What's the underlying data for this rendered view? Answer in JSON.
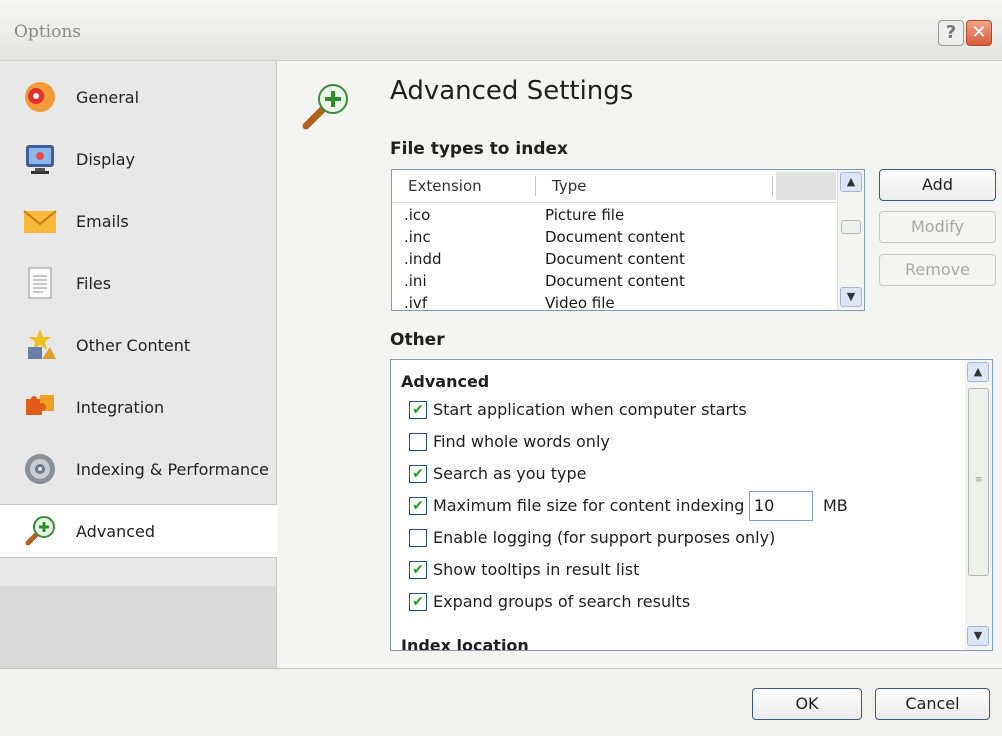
{
  "window": {
    "title": "Options",
    "help_label": "?",
    "close_label": "✕"
  },
  "sidebar": {
    "items": [
      {
        "label": "General",
        "icon": "general-settings-icon"
      },
      {
        "label": "Display",
        "icon": "monitor-icon"
      },
      {
        "label": "Emails",
        "icon": "envelope-icon"
      },
      {
        "label": "Files",
        "icon": "document-icon"
      },
      {
        "label": "Other Content",
        "icon": "other-content-icon"
      },
      {
        "label": "Integration",
        "icon": "puzzle-icon"
      },
      {
        "label": "Indexing & Performance",
        "icon": "gear-icon"
      },
      {
        "label": "Advanced",
        "icon": "magnifier-plus-icon",
        "active": true
      }
    ]
  },
  "main": {
    "title": "Advanced Settings",
    "file_types": {
      "heading": "File types to index",
      "columns": [
        "Extension",
        "Type"
      ],
      "rows": [
        {
          "ext": ".ico",
          "type": "Picture file"
        },
        {
          "ext": ".inc",
          "type": "Document content"
        },
        {
          "ext": ".indd",
          "type": "Document content"
        },
        {
          "ext": ".ini",
          "type": "Document content"
        },
        {
          "ext": ".ivf",
          "type": "Video file"
        }
      ],
      "buttons": {
        "add": "Add",
        "modify": "Modify",
        "remove": "Remove"
      }
    },
    "other": {
      "heading": "Other",
      "group_advanced": "Advanced",
      "options": [
        {
          "label": "Start application when computer starts",
          "checked": true
        },
        {
          "label": "Find whole words only",
          "checked": false
        },
        {
          "label": "Search as you type",
          "checked": true
        },
        {
          "label": "Maximum file size for content indexing",
          "checked": true
        },
        {
          "label": "Enable logging (for support purposes only)",
          "checked": false
        },
        {
          "label": "Show tooltips in result list",
          "checked": true
        },
        {
          "label": "Expand groups of search results",
          "checked": true
        }
      ],
      "max_file_size_value": "10",
      "max_file_size_unit": "MB",
      "group_index_location": "Index location"
    }
  },
  "footer": {
    "ok": "OK",
    "cancel": "Cancel"
  },
  "checkmark_glyph": "✔",
  "scroll": {
    "up": "▲",
    "down": "▼"
  }
}
